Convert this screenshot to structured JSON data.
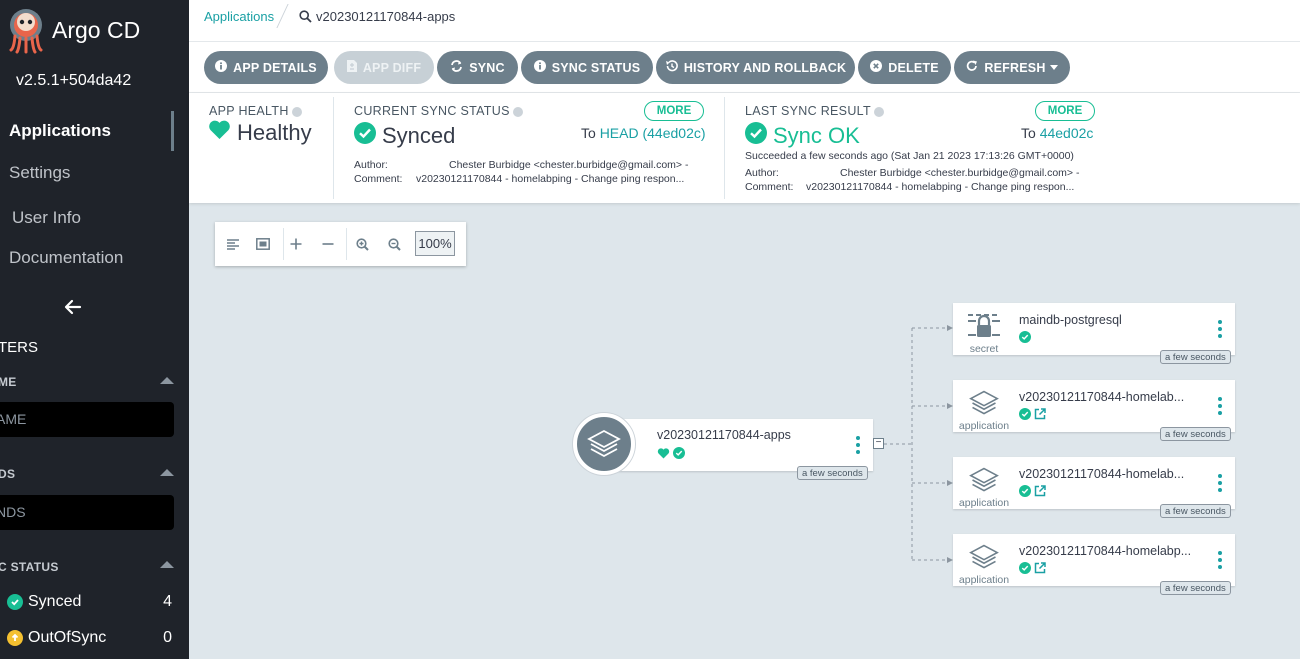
{
  "app": {
    "brand": "Argo CD",
    "version": "v2.5.1+504da42"
  },
  "sidebar": {
    "nav": [
      {
        "label": "Applications"
      },
      {
        "label": "Settings"
      },
      {
        "label": "User Info"
      },
      {
        "label": "Documentation"
      }
    ],
    "filters_title": "TERS",
    "filters": [
      {
        "label": "ME",
        "placeholder": "AME"
      },
      {
        "label": "DS",
        "placeholder": "NDS"
      }
    ],
    "sync_status_label": "C STATUS",
    "sync_status": [
      {
        "label": "Synced",
        "count": "4",
        "color": "#18be94"
      },
      {
        "label": "OutOfSync",
        "count": "0",
        "color": "#f4c030"
      }
    ]
  },
  "breadcrumb": {
    "link": "Applications",
    "current": "v20230121170844-apps"
  },
  "toolbar": {
    "app_details": "APP DETAILS",
    "app_diff": "APP DIFF",
    "sync": "SYNC",
    "sync_status": "SYNC STATUS",
    "history": "HISTORY AND ROLLBACK",
    "delete": "DELETE",
    "refresh": "REFRESH"
  },
  "status": {
    "health": {
      "label": "APP HEALTH",
      "value": "Healthy"
    },
    "current_sync": {
      "label": "CURRENT SYNC STATUS",
      "value": "Synced",
      "more": "MORE",
      "to_prefix": "To ",
      "to_value": "HEAD (44ed02c)",
      "author_label": "Author:",
      "author": "Chester Burbidge <chester.burbidge@gmail.com> -",
      "comment_label": "Comment:",
      "comment": "v20230121170844 - homelabping - Change ping respon..."
    },
    "last_sync": {
      "label": "LAST SYNC RESULT",
      "value": "Sync OK",
      "more": "MORE",
      "to_prefix": "To ",
      "to_value": "44ed02c",
      "succeeded": "Succeeded a few seconds ago (Sat Jan 21 2023 17:13:26 GMT+0000)",
      "author_label": "Author:",
      "author": "Chester Burbidge <chester.burbidge@gmail.com> -",
      "comment_label": "Comment:",
      "comment": "v20230121170844 - homelabping - Change ping respon..."
    },
    "colors": {
      "healthy": "#18be94",
      "accent": "#1aa0a4"
    }
  },
  "graph": {
    "zoom": "100%",
    "root": {
      "title": "v20230121170844-apps",
      "time": "a few seconds"
    },
    "children": [
      {
        "title": "maindb-postgresql",
        "kind": "secret",
        "time": "a few seconds"
      },
      {
        "title": "v20230121170844-homelab...",
        "kind": "application",
        "time": "a few seconds"
      },
      {
        "title": "v20230121170844-homelab...",
        "kind": "application",
        "time": "a few seconds"
      },
      {
        "title": "v20230121170844-homelabp...",
        "kind": "application",
        "time": "a few seconds"
      }
    ]
  }
}
